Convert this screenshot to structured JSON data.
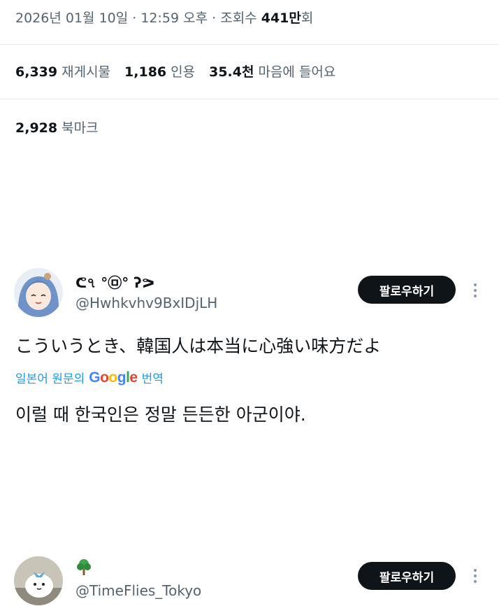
{
  "tweet_meta": {
    "date_time": "2026년 01월 10일 · 12:59 오후 · 조회수",
    "views": "441만",
    "views_suffix": "회"
  },
  "stats": {
    "reposts_count": "6,339",
    "reposts_label": "재게시물",
    "quotes_count": "1,186",
    "quotes_label": "인용",
    "likes_count": "35.4천",
    "likes_label": "마음에 들어요",
    "bookmarks_count": "2,928",
    "bookmarks_label": "북마크"
  },
  "reply1": {
    "display_name": "ᕦ৭ °㉤° ʔᕗ",
    "handle": "@Hwhkvhv9BxIDjLH",
    "follow_label": "팔로우하기",
    "original_text": "こういうとき、韓国人は本当に心強い味方だよ",
    "translate_prefix": "일본어 원문의",
    "translate_brand": "Google",
    "translate_suffix": "번역",
    "translated_text": "이럴 때 한국인은 정말 든든한 아군이야."
  },
  "reply2": {
    "handle": "@TimeFlies_Tokyo",
    "follow_label": "팔로우하기",
    "name_icon": "tree-icon"
  },
  "colors": {
    "accent": "#1d9bf0",
    "button_bg": "#0f1419",
    "secondary_text": "#536471"
  }
}
